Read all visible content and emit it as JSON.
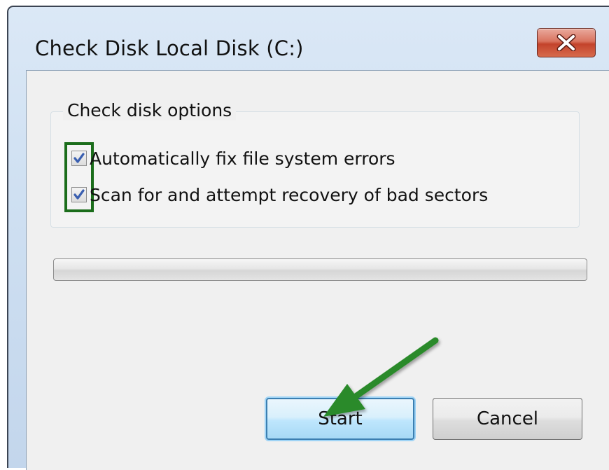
{
  "dialog": {
    "title": "Check Disk Local Disk (C:)",
    "close_label": "×"
  },
  "options_group": {
    "label": "Check disk options",
    "options": [
      {
        "label": "Automatically fix file system errors",
        "checked": true
      },
      {
        "label": "Scan for and attempt recovery of bad sectors",
        "checked": true
      }
    ]
  },
  "progress": {
    "value_percent": 0
  },
  "buttons": {
    "start_label": "Start",
    "cancel_label": "Cancel"
  },
  "colors": {
    "annotation_green": "#2a8a2a",
    "highlight_box": "#1b6d1b",
    "close_button_red": "#c3432b",
    "default_button_border": "#3c7fb1"
  },
  "icons": {
    "close": "close-x-icon",
    "check": "checkmark-icon",
    "annotation": "green-arrow-annotation"
  }
}
